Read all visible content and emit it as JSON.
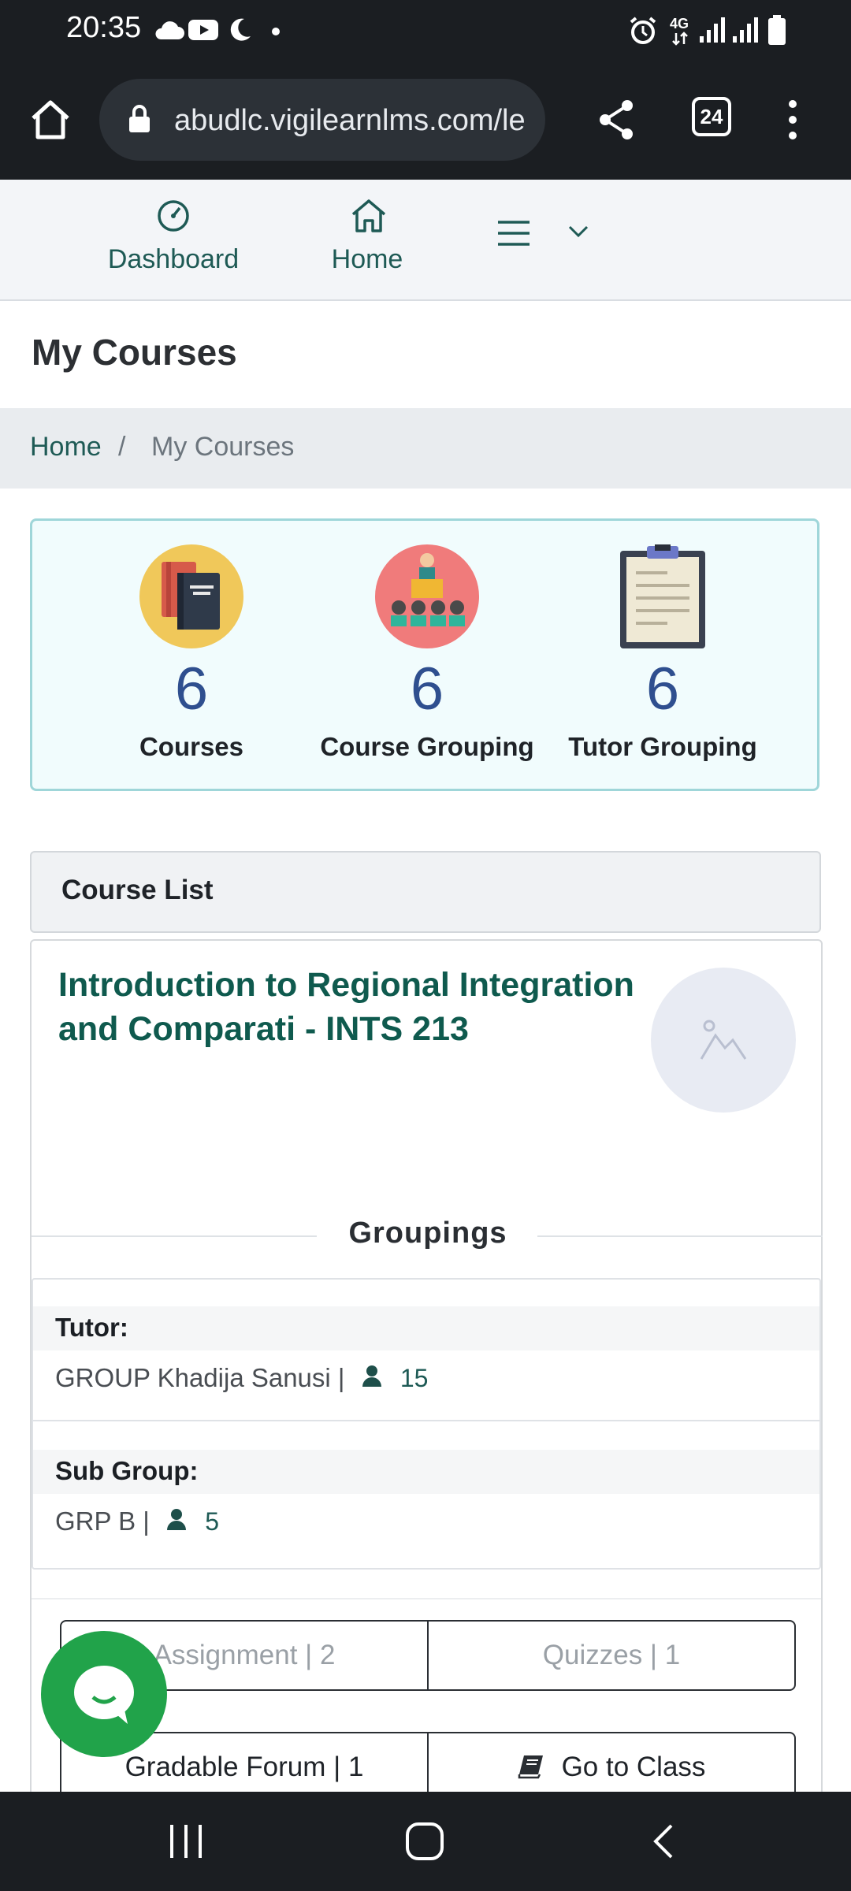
{
  "status": {
    "time": "20:35",
    "network": "4G"
  },
  "browser": {
    "url": "abudlc.vigilearnlms.com/le",
    "tab_count": "24"
  },
  "nav": {
    "dashboard": "Dashboard",
    "home": "Home"
  },
  "page": {
    "title": "My Courses"
  },
  "breadcrumb": {
    "home": "Home",
    "sep": "/",
    "current": "My Courses"
  },
  "stats": [
    {
      "value": "6",
      "label": "Courses"
    },
    {
      "value": "6",
      "label": "Course Grouping"
    },
    {
      "value": "6",
      "label": "Tutor Grouping"
    }
  ],
  "course_list": {
    "header": "Course List",
    "course": {
      "title": "Introduction to Regional Integration and Comparati - INTS 213",
      "groupings_label": "Groupings",
      "tutor_label": "Tutor:",
      "tutor_value": "GROUP Khadija Sanusi |",
      "tutor_count": "15",
      "subgroup_label": "Sub Group:",
      "subgroup_value": "GRP B |",
      "subgroup_count": "5",
      "buttons": {
        "assignment": "Assignment | 2",
        "quizzes": "Quizzes | 1",
        "forum": "Gradable Forum | 1",
        "go_to_class": "Go to Class"
      }
    }
  }
}
